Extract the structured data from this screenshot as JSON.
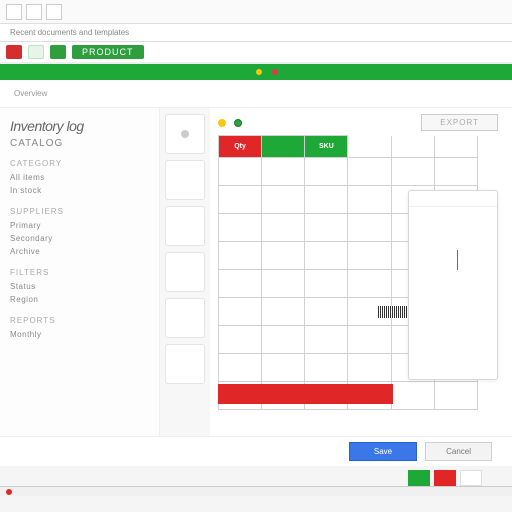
{
  "toolbar": {
    "icons": [
      "file-icon",
      "folder-icon",
      "recent-icon"
    ]
  },
  "tabs": {
    "label": "Recent documents and templates"
  },
  "ribbon": {
    "product": "PRODUCT"
  },
  "subnav": {
    "items": [
      "Overview",
      "",
      "",
      ""
    ]
  },
  "sidebar": {
    "title": "Inventory log",
    "subtitle": "CATALOG",
    "groups": [
      {
        "head": "CATEGORY",
        "items": [
          "All items",
          "In stock"
        ]
      },
      {
        "head": "SUPPLIERS",
        "items": [
          "Primary",
          "Secondary",
          "Archive"
        ]
      },
      {
        "head": "FILTERS",
        "items": [
          "Status",
          "Region"
        ]
      },
      {
        "head": "REPORTS",
        "items": [
          "Monthly"
        ]
      }
    ]
  },
  "content": {
    "action_button": "EXPORT",
    "grid": {
      "headers": [
        {
          "label": "Qty",
          "style": "red"
        },
        {
          "label": "",
          "style": "green"
        },
        {
          "label": "SKU",
          "style": "green"
        },
        {
          "label": "",
          "style": "blank"
        },
        {
          "label": "",
          "style": "blank"
        },
        {
          "label": "",
          "style": "blank"
        }
      ],
      "rows": 9,
      "cols": 6
    }
  },
  "footer": {
    "primary": "Save",
    "secondary": "Cancel"
  },
  "colors": {
    "green": "#1ea838",
    "red": "#e02626",
    "blue": "#3b78e7",
    "yellow": "#f9c80e"
  }
}
